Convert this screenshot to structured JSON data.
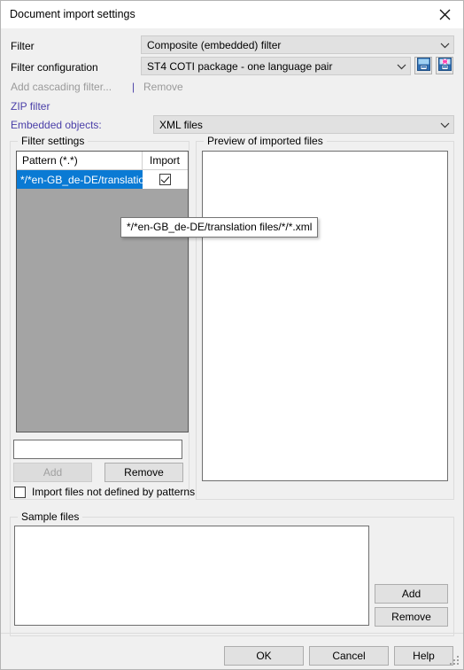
{
  "window": {
    "title": "Document import settings",
    "close_icon": "close-icon"
  },
  "form": {
    "filter_label": "Filter",
    "filter_value": "Composite (embedded) filter",
    "filter_configuration_label": "Filter configuration",
    "filter_configuration_value": "ST4 COTI package - one language pair",
    "save_config_icon": "save-configuration-icon",
    "save_config_as_icon": "save-configuration-as-new-icon",
    "add_cascading_filter_label": "Add cascading filter...",
    "separator": "|",
    "remove_cascading_label": "Remove",
    "zip_filter_link": "ZIP filter",
    "embedded_objects_label": "Embedded objects:",
    "embedded_objects_value": "XML files"
  },
  "filter_settings": {
    "group_title": "Filter settings",
    "columns": [
      "Pattern (*.*)",
      "Import"
    ],
    "rows": [
      {
        "pattern": "*/*en-GB_de-DE/translatio...",
        "import": true,
        "selected": true
      }
    ],
    "pattern_input_value": "",
    "add_button": "Add",
    "remove_button": "Remove",
    "import_undefined_checkbox": "Import files not defined by patterns",
    "import_undefined_checked": false
  },
  "preview": {
    "group_title": "Preview of imported files",
    "items": []
  },
  "tooltip": {
    "text": "*/*en-GB_de-DE/translation files/*/*.xml"
  },
  "sample_files": {
    "group_title": "Sample files",
    "items": [],
    "add_button": "Add",
    "remove_button": "Remove"
  },
  "footer": {
    "ok": "OK",
    "cancel": "Cancel",
    "help": "Help"
  },
  "colors": {
    "accent_selection": "#0a7ad4",
    "link": "#4a3fa8",
    "dialog_bg": "#f0f0f0",
    "list_bg": "#a4a4a4"
  }
}
